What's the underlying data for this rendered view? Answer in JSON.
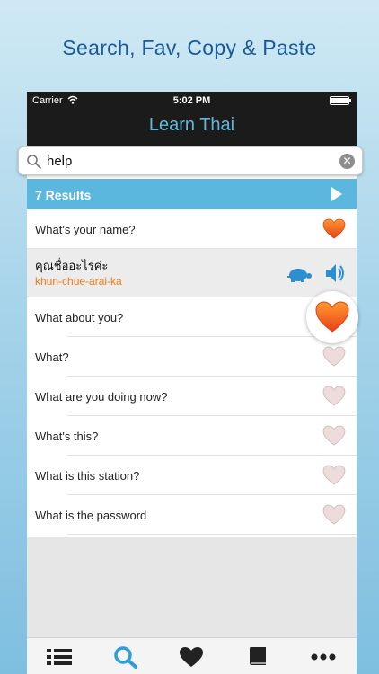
{
  "headline": "Search, Fav, Copy & Paste",
  "status": {
    "carrier": "Carrier",
    "time": "5:02 PM"
  },
  "navbar": {
    "title": "Learn Thai"
  },
  "search": {
    "query": "help",
    "clear_symbol": "✕"
  },
  "results": {
    "label": "7 Results"
  },
  "phrases": [
    {
      "text": "What's your name?",
      "favorite": true
    },
    {
      "text": "What about you?",
      "favorite": true
    },
    {
      "text": "What?",
      "favorite": false
    },
    {
      "text": "What are you doing now?",
      "favorite": false
    },
    {
      "text": "What's this?",
      "favorite": false
    },
    {
      "text": "What is this station?",
      "favorite": false
    },
    {
      "text": "What is the password",
      "favorite": false
    }
  ],
  "detail": {
    "thai": "คุณชื่ออะไรค่ะ",
    "romanized": "khun-chue-arai-ka"
  },
  "tabs": [
    "list-icon",
    "search-icon",
    "heart-icon",
    "book-icon",
    "more-icon"
  ],
  "colors": {
    "accent": "#5bb7dd",
    "heart_active": "#f05a1a",
    "heart_inactive": "#e9d6d6",
    "romanized": "#ee7a1b",
    "headline": "#1a5a9a"
  }
}
